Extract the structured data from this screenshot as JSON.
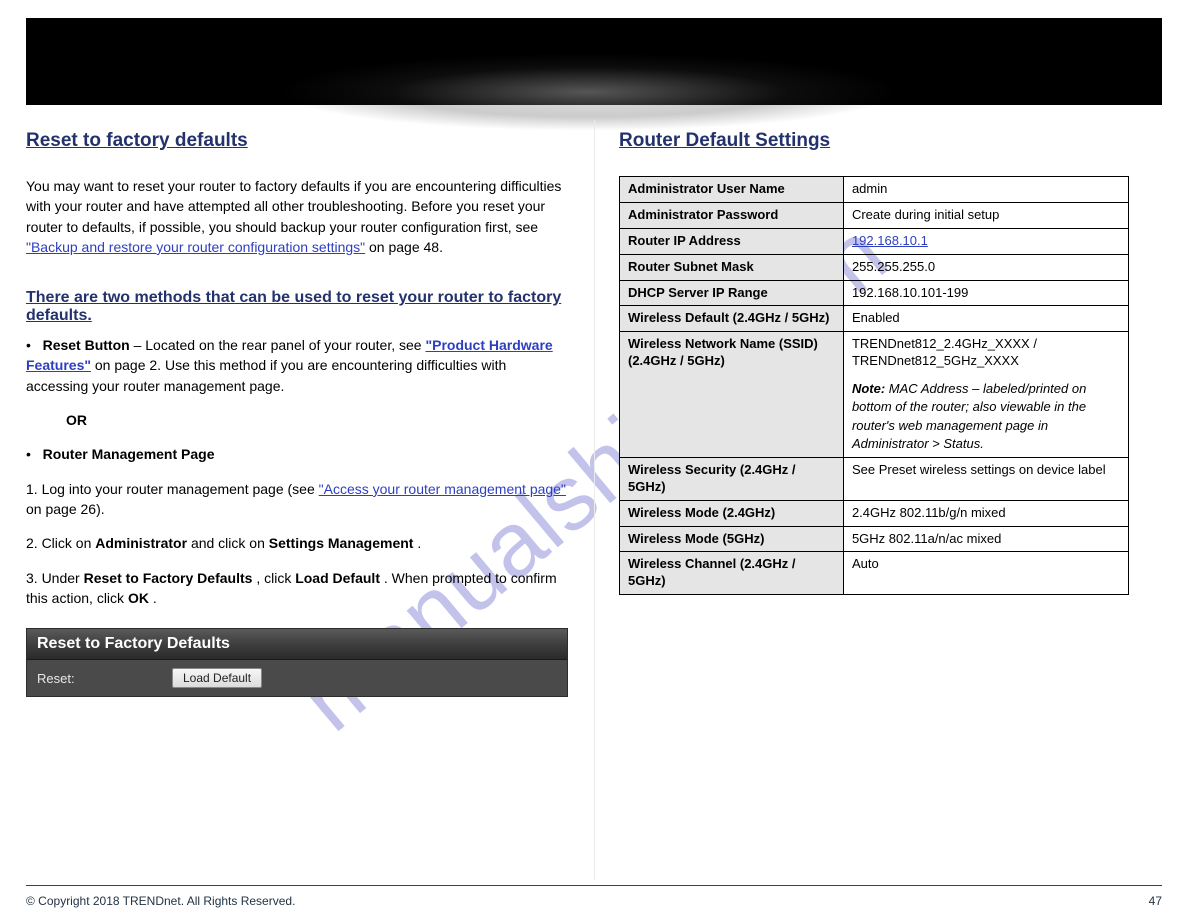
{
  "watermark": "manualshive.com",
  "left": {
    "heading": "Reset to factory defaults",
    "para1_a": "You may want to reset your router to factory defaults if you are encountering difficulties with your router and have attempted all other troubleshooting. Before you reset your router to defaults, if possible, you should backup your router configuration first, see ",
    "para1_link": "\"Backup and restore your router configuration settings\"",
    "para1_b": " on page 48.",
    "sub_heading": "There are two methods that can be used to reset your router to factory defaults.",
    "bullet_sym": "•",
    "bullet1_a": "Reset Button",
    "bullet1_b": " – Located on the rear panel of your router, see ",
    "bullet1_link": "\"Product Hardware Features\"",
    "bullet1_c": " on page 2. Use this method if you are encountering difficulties with accessing your router management page.",
    "or": "OR",
    "bullet2_a": "Router Management Page",
    "step1": "1.  Log into your router management page (see ",
    "step1_link": "\"Access your router management page\"",
    "step1_b": " on page 26).",
    "step2": "2.  Click on ",
    "step2_b1": "Administrator",
    "step2_mid": " and click on ",
    "step2_b2": "Settings Management",
    "step2_end": ".",
    "step3_a": "3.  Under ",
    "step3_b1": "Reset to Factory Defaults",
    "step3_mid": ", click ",
    "step3_b2": "Load Default",
    "step3_end": ". When prompted to confirm this action, click ",
    "step3_b3": "OK",
    "step3_tail": ".",
    "panel_title": "Reset to Factory Defaults",
    "panel_row_label": "Reset:",
    "panel_button": "Load Default"
  },
  "right": {
    "heading": "Router Default Settings",
    "rows": [
      {
        "k": "Administrator User Name",
        "v": "admin"
      },
      {
        "k": "Administrator Password",
        "v": "Create during initial setup"
      },
      {
        "k": "Router IP Address",
        "v": "192.168.10.1",
        "link": true
      },
      {
        "k": "Router Subnet Mask",
        "v": "255.255.255.0"
      },
      {
        "k": "DHCP Server IP Range",
        "v": "192.168.10.101-199"
      },
      {
        "k": "Wireless Default (2.4GHz / 5GHz)",
        "v": "Enabled"
      },
      {
        "k": "Wireless Network Name (SSID) (2.4GHz / 5GHz)",
        "v": "TRENDnet812_2.4GHz_XXXX / TRENDnet812_5GHz_XXXX",
        "italic": true
      },
      {
        "k": "Wireless Security (2.4GHz / 5GHz)",
        "v": "See Preset wireless settings on device label"
      },
      {
        "k": "Wireless Mode (2.4GHz)",
        "v": "2.4GHz 802.11b/g/n mixed"
      },
      {
        "k": "Wireless Mode (5GHz)",
        "v": "5GHz 802.11a/n/ac mixed"
      },
      {
        "k": "Wireless Channel (2.4GHz / 5GHz)",
        "v": "Auto"
      }
    ],
    "note_a": "Note: ",
    "note_b": "MAC Address – labeled/printed on bottom of the router; also viewable in the router's web management page in Administrator > Status."
  },
  "footer": {
    "copyright": "© Copyright 2018 TRENDnet. All Rights Reserved.",
    "page": "47"
  }
}
